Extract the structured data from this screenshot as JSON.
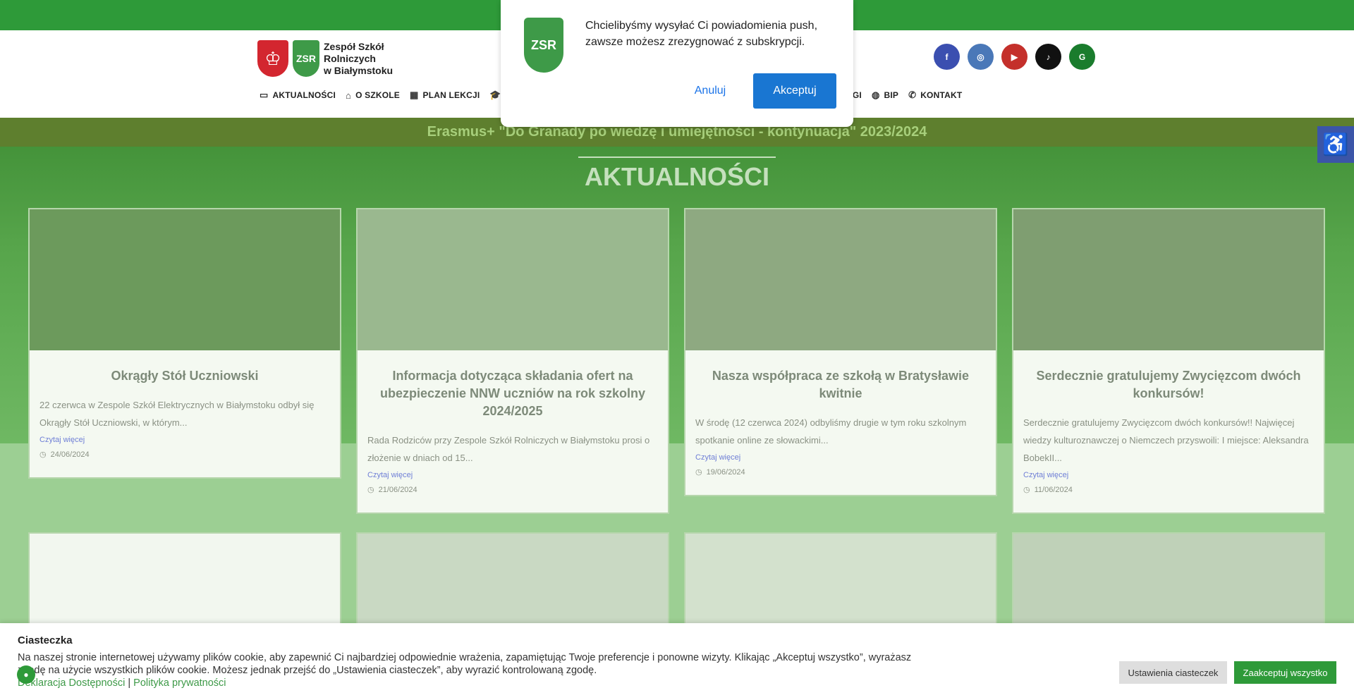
{
  "site": {
    "logo_line1": "Zespół Szkół Rolniczych",
    "logo_line2": "w Białymstoku",
    "crest_text": "ZSR"
  },
  "social": [
    {
      "name": "facebook",
      "glyph": "f",
      "color": "#3b4fb0"
    },
    {
      "name": "instagram",
      "glyph": "◎",
      "color": "#4a78b8"
    },
    {
      "name": "youtube",
      "glyph": "▶",
      "color": "#c4302b"
    },
    {
      "name": "tiktok",
      "glyph": "♪",
      "color": "#111111"
    },
    {
      "name": "other",
      "glyph": "G",
      "color": "#1a7c2d"
    }
  ],
  "nav": {
    "items": [
      {
        "label": "AKTUALNOŚCI",
        "icon": "▭"
      },
      {
        "label": "O SZKOLE",
        "icon": "⌂"
      },
      {
        "label": "PLAN LEKCJI",
        "icon": "▦"
      }
    ],
    "right_items": [
      {
        "label": "RGI",
        "icon": ""
      },
      {
        "label": "BIP",
        "icon": "◍"
      },
      {
        "label": "KONTAKT",
        "icon": "✆"
      }
    ]
  },
  "banner": "Erasmus+ \"Do Granady po wiedzę i umiejętności - kontynuacja\" 2023/2024",
  "hero_title": "AKTUALNOŚCI",
  "cards": [
    {
      "title": "Okrągły Stół Uczniowski",
      "excerpt": "22 czerwca w Zespole Szkół Elektrycznych w Białymstoku odbył się Okrągły Stół Uczniowski, w którym...",
      "more": "Czytaj więcej",
      "date": "24/06/2024"
    },
    {
      "title": "Informacja dotycząca składania ofert na ubezpieczenie NNW uczniów na rok szkolny 2024/2025",
      "excerpt": "Rada Rodziców przy Zespole Szkół Rolniczych w Białymstoku prosi o złożenie w dniach od 15...",
      "more": "Czytaj więcej",
      "date": "21/06/2024"
    },
    {
      "title": "Nasza współpraca ze szkołą w Bratysławie kwitnie",
      "excerpt": "W środę (12 czerwca 2024) odbyliśmy drugie w tym roku szkolnym spotkanie online ze słowackimi...",
      "more": "Czytaj więcej",
      "date": "19/06/2024"
    },
    {
      "title": "Serdecznie gratulujemy Zwycięzcom dwóch konkursów!",
      "excerpt": "Serdecznie gratulujemy Zwycięzcom dwóch konkursów!! Najwięcej wiedzy kulturoznawczej o Niemczech przyswoili: I miejsce: Aleksandra BobekII...",
      "more": "Czytaj więcej",
      "date": "11/06/2024"
    }
  ],
  "push": {
    "text": "Chcielibyśmy wysyłać Ci powiadomienia push, zawsze możesz zrezygnować z subskrypcji.",
    "cancel": "Anuluj",
    "accept": "Akceptuj"
  },
  "cookie": {
    "title": "Ciasteczka",
    "text": "Na naszej stronie internetowej używamy plików cookie, aby zapewnić Ci najbardziej odpowiednie wrażenia, zapamiętując Twoje preferencje i ponowne wizyty. Klikając „Akceptuj wszystko”, wyrażasz zgodę na użycie wszystkich plików cookie. Możesz jednak przejść do „Ustawienia ciasteczek”, aby wyrazić kontrolowaną zgodę.",
    "link1": "Deklaracja Dostępności",
    "sep": " | ",
    "link2": "Polityka prywatności",
    "settings": "Ustawienia ciasteczek",
    "accept_all": "Zaakceptuj wszystko"
  },
  "accessibility_icon": "accessibility-icon"
}
